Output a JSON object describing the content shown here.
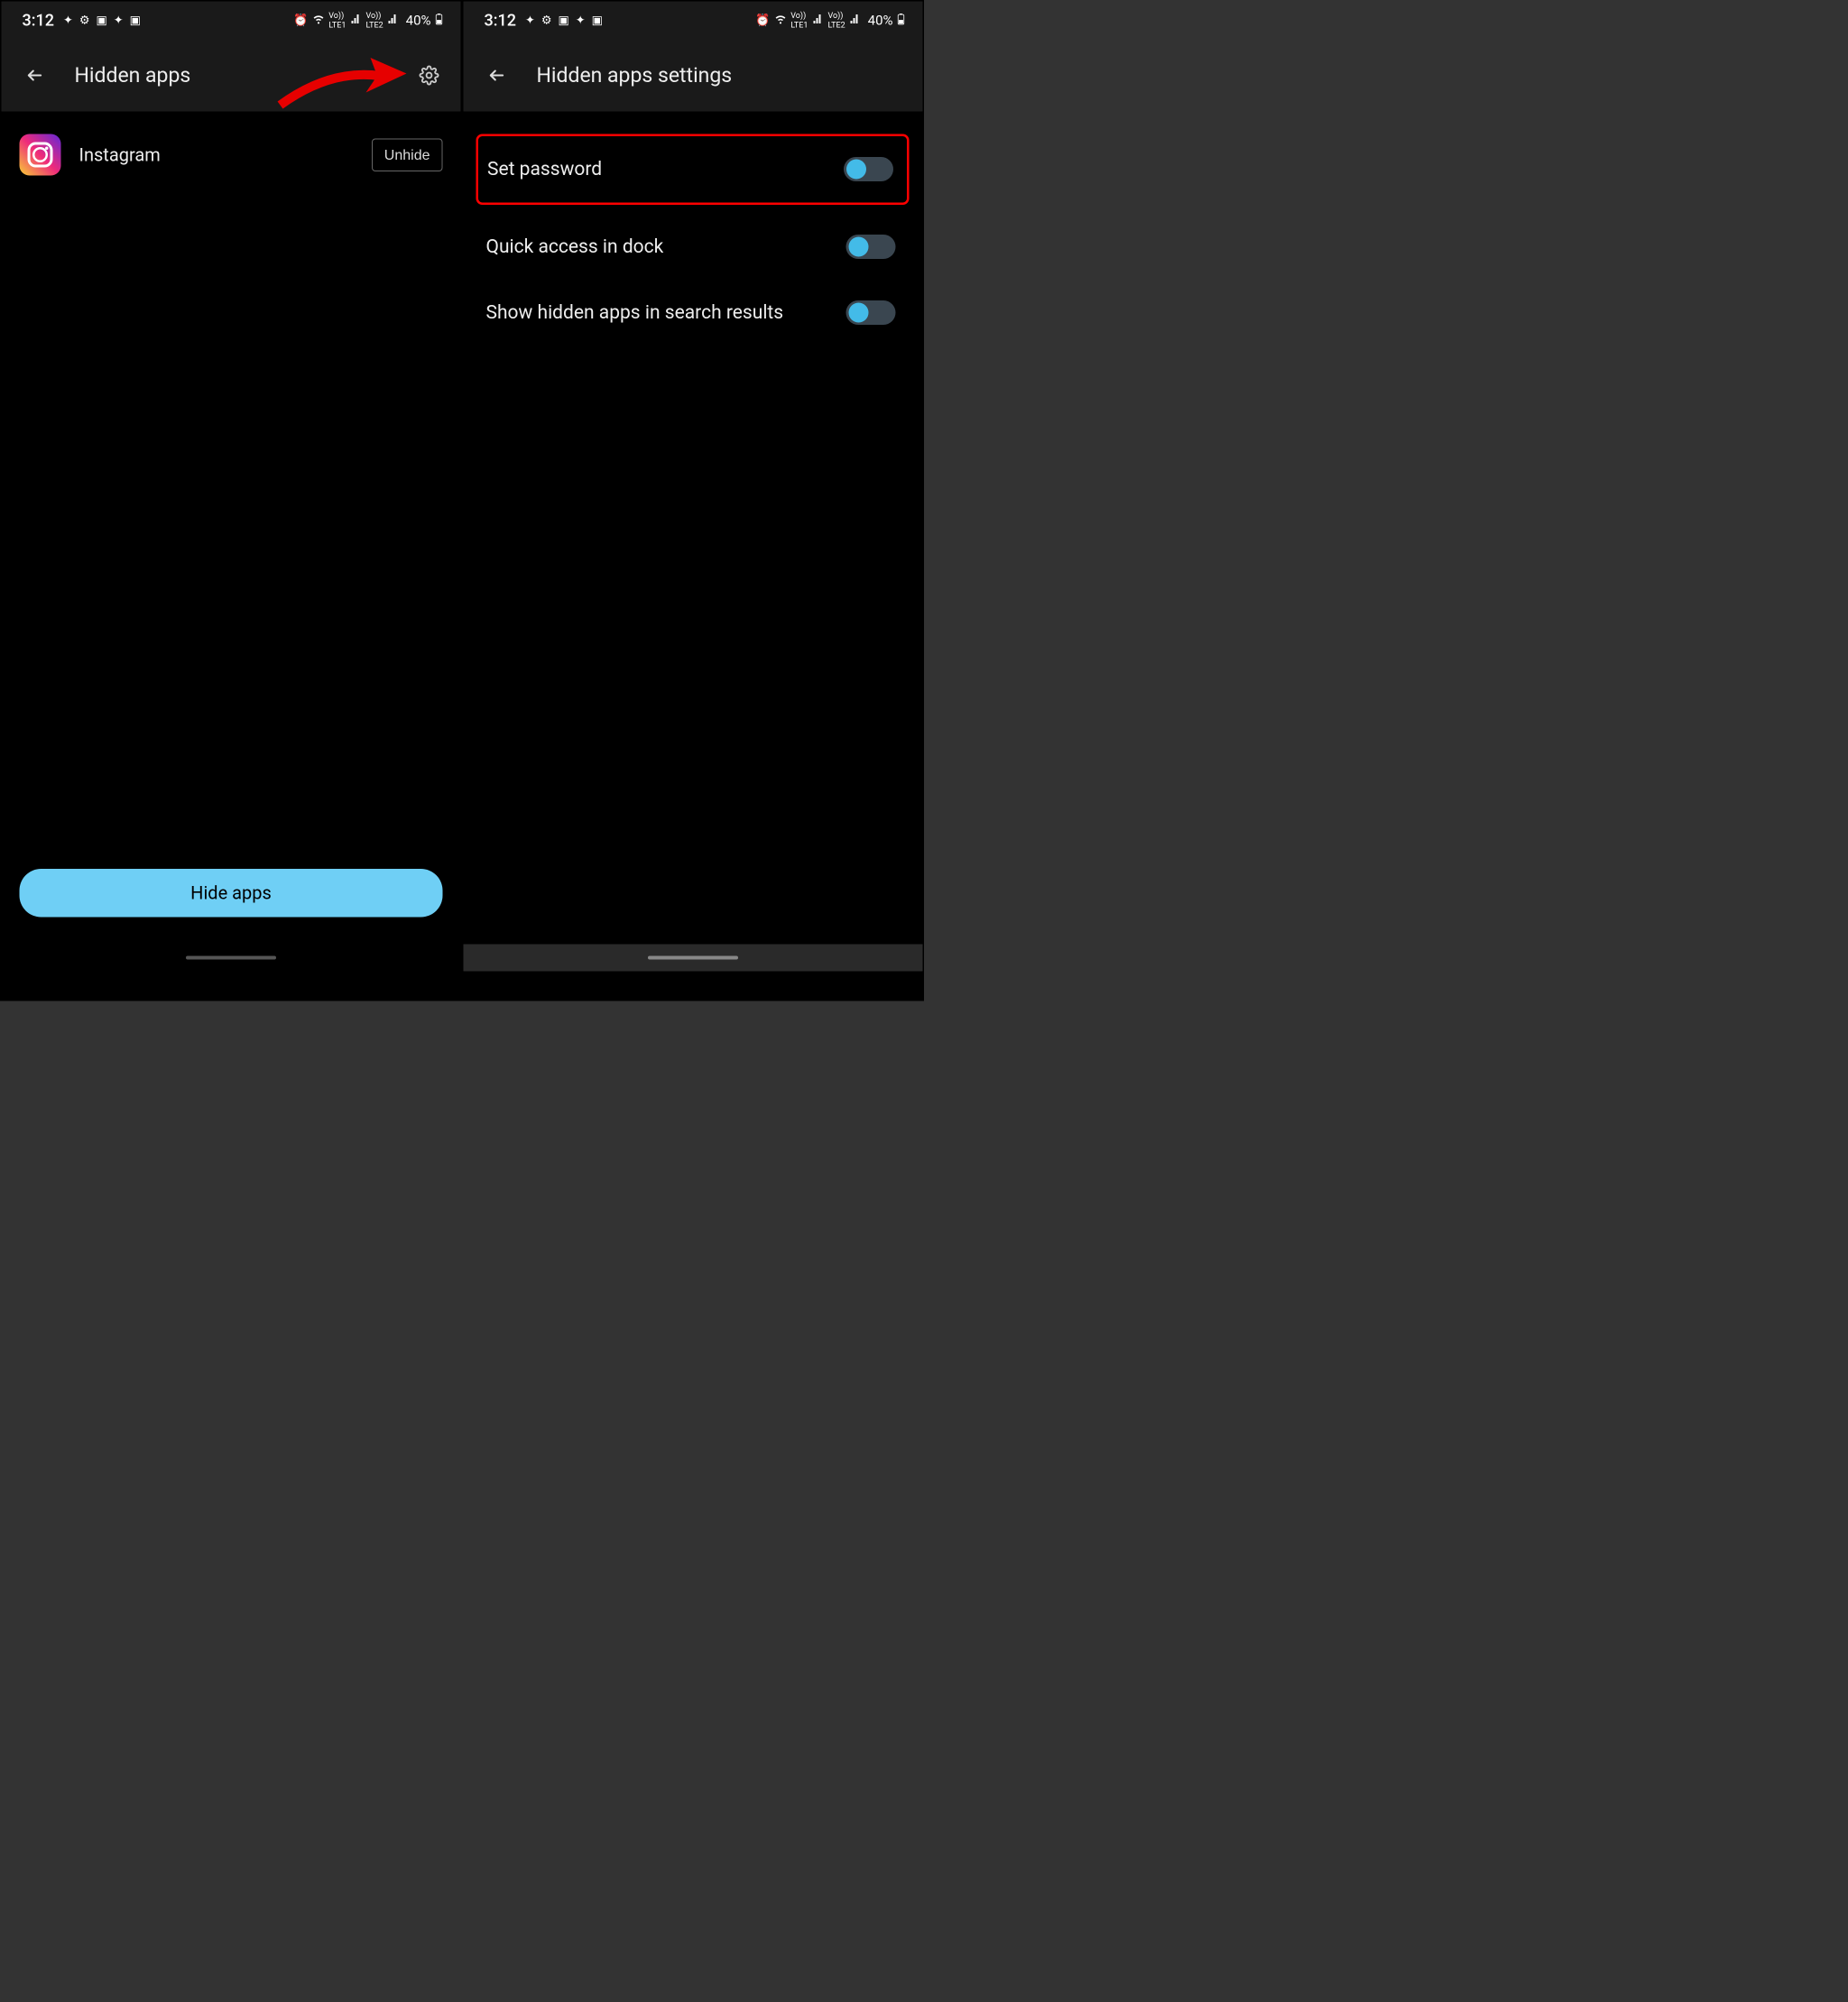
{
  "statusbar": {
    "time": "3:12",
    "battery": "40%",
    "icons_left": [
      "link",
      "gear",
      "image",
      "link",
      "image"
    ],
    "icons_right": [
      "alarm",
      "wifi",
      "VoLTE1",
      "signal",
      "VoLTE2",
      "signal"
    ]
  },
  "left_screen": {
    "title": "Hidden apps",
    "app": {
      "name": "Instagram",
      "action_label": "Unhide"
    },
    "bottom_button": "Hide apps"
  },
  "right_screen": {
    "title": "Hidden apps settings",
    "settings": [
      {
        "label": "Set password",
        "enabled": true,
        "highlighted": true
      },
      {
        "label": "Quick access in dock",
        "enabled": true,
        "highlighted": false
      },
      {
        "label": "Show hidden apps in search results",
        "enabled": true,
        "highlighted": false
      }
    ]
  }
}
